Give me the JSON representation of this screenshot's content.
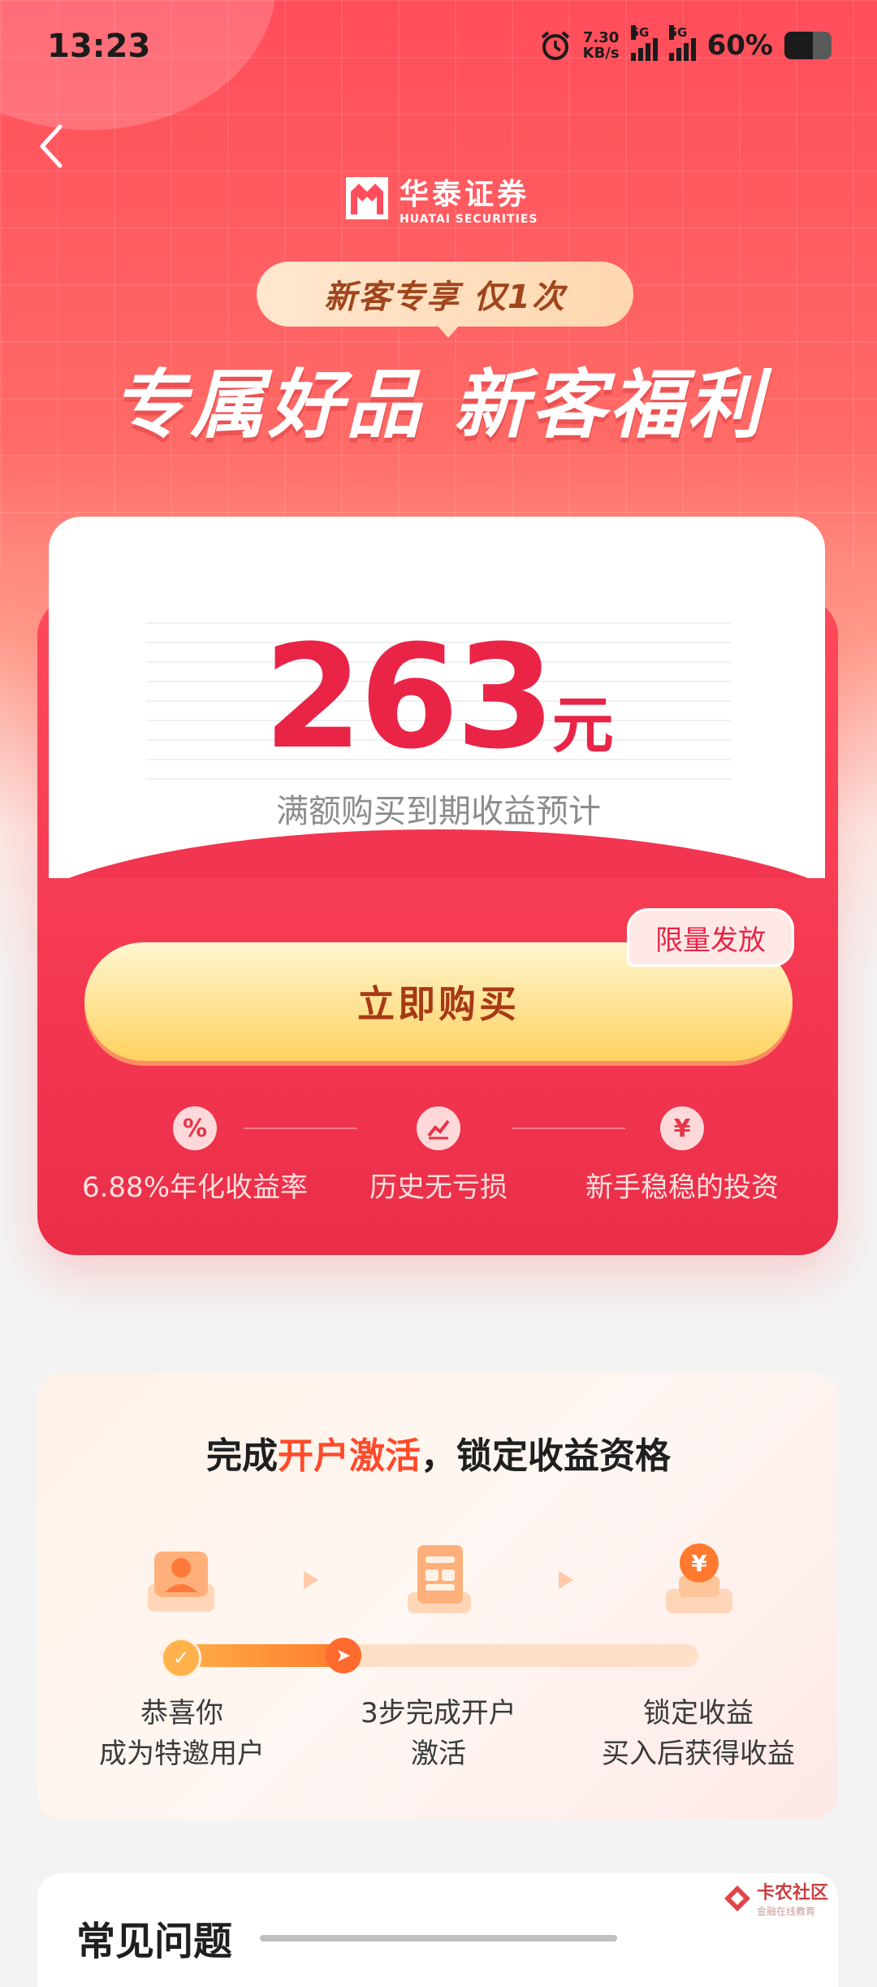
{
  "status_bar": {
    "time": "13:23",
    "net_speed_value": "7.30",
    "net_speed_unit": "KB/s",
    "sim1": "5G",
    "sim2": "5G",
    "battery": "60%"
  },
  "header": {
    "brand_cn": "华泰证券",
    "brand_en": "HUATAI SECURITIES",
    "pill": "新客专享  仅1次",
    "headline": "专属好品 新客福利"
  },
  "offer": {
    "amount": "263",
    "unit": "元",
    "amount_label": "满额购买到期收益预计",
    "limit_tag": "限量发放",
    "buy_button": "立即购买",
    "features": [
      {
        "icon": "percent-icon",
        "glyph": "%",
        "label": "6.88%年化收益率"
      },
      {
        "icon": "trend-chart-icon",
        "glyph": "",
        "label": "历史无亏损"
      },
      {
        "icon": "money-bag-icon",
        "glyph": "¥",
        "label": "新手稳稳的投资"
      }
    ]
  },
  "steps": {
    "title_prefix": "完成",
    "title_highlight": "开户激活",
    "title_suffix": "，锁定收益资格",
    "progress_fraction": 0.34,
    "items": [
      {
        "icon": "user-badge-icon",
        "line1": "恭喜你",
        "line2": "成为特邀用户"
      },
      {
        "icon": "form-document-icon",
        "line1": "3步完成开户",
        "line2": "激活"
      },
      {
        "icon": "yuan-coin-icon",
        "line1": "锁定收益",
        "line2": "买入后获得收益"
      }
    ]
  },
  "faq": {
    "title": "常见问题"
  },
  "watermark": {
    "name": "卡农社区",
    "sub": "金融在线教育"
  },
  "colors": {
    "brand_red": "#f23550",
    "amount_red": "#ea2447",
    "button_gold": "#ffe08d",
    "button_text": "#a73a16",
    "highlight_orange": "#ff4a2a"
  }
}
